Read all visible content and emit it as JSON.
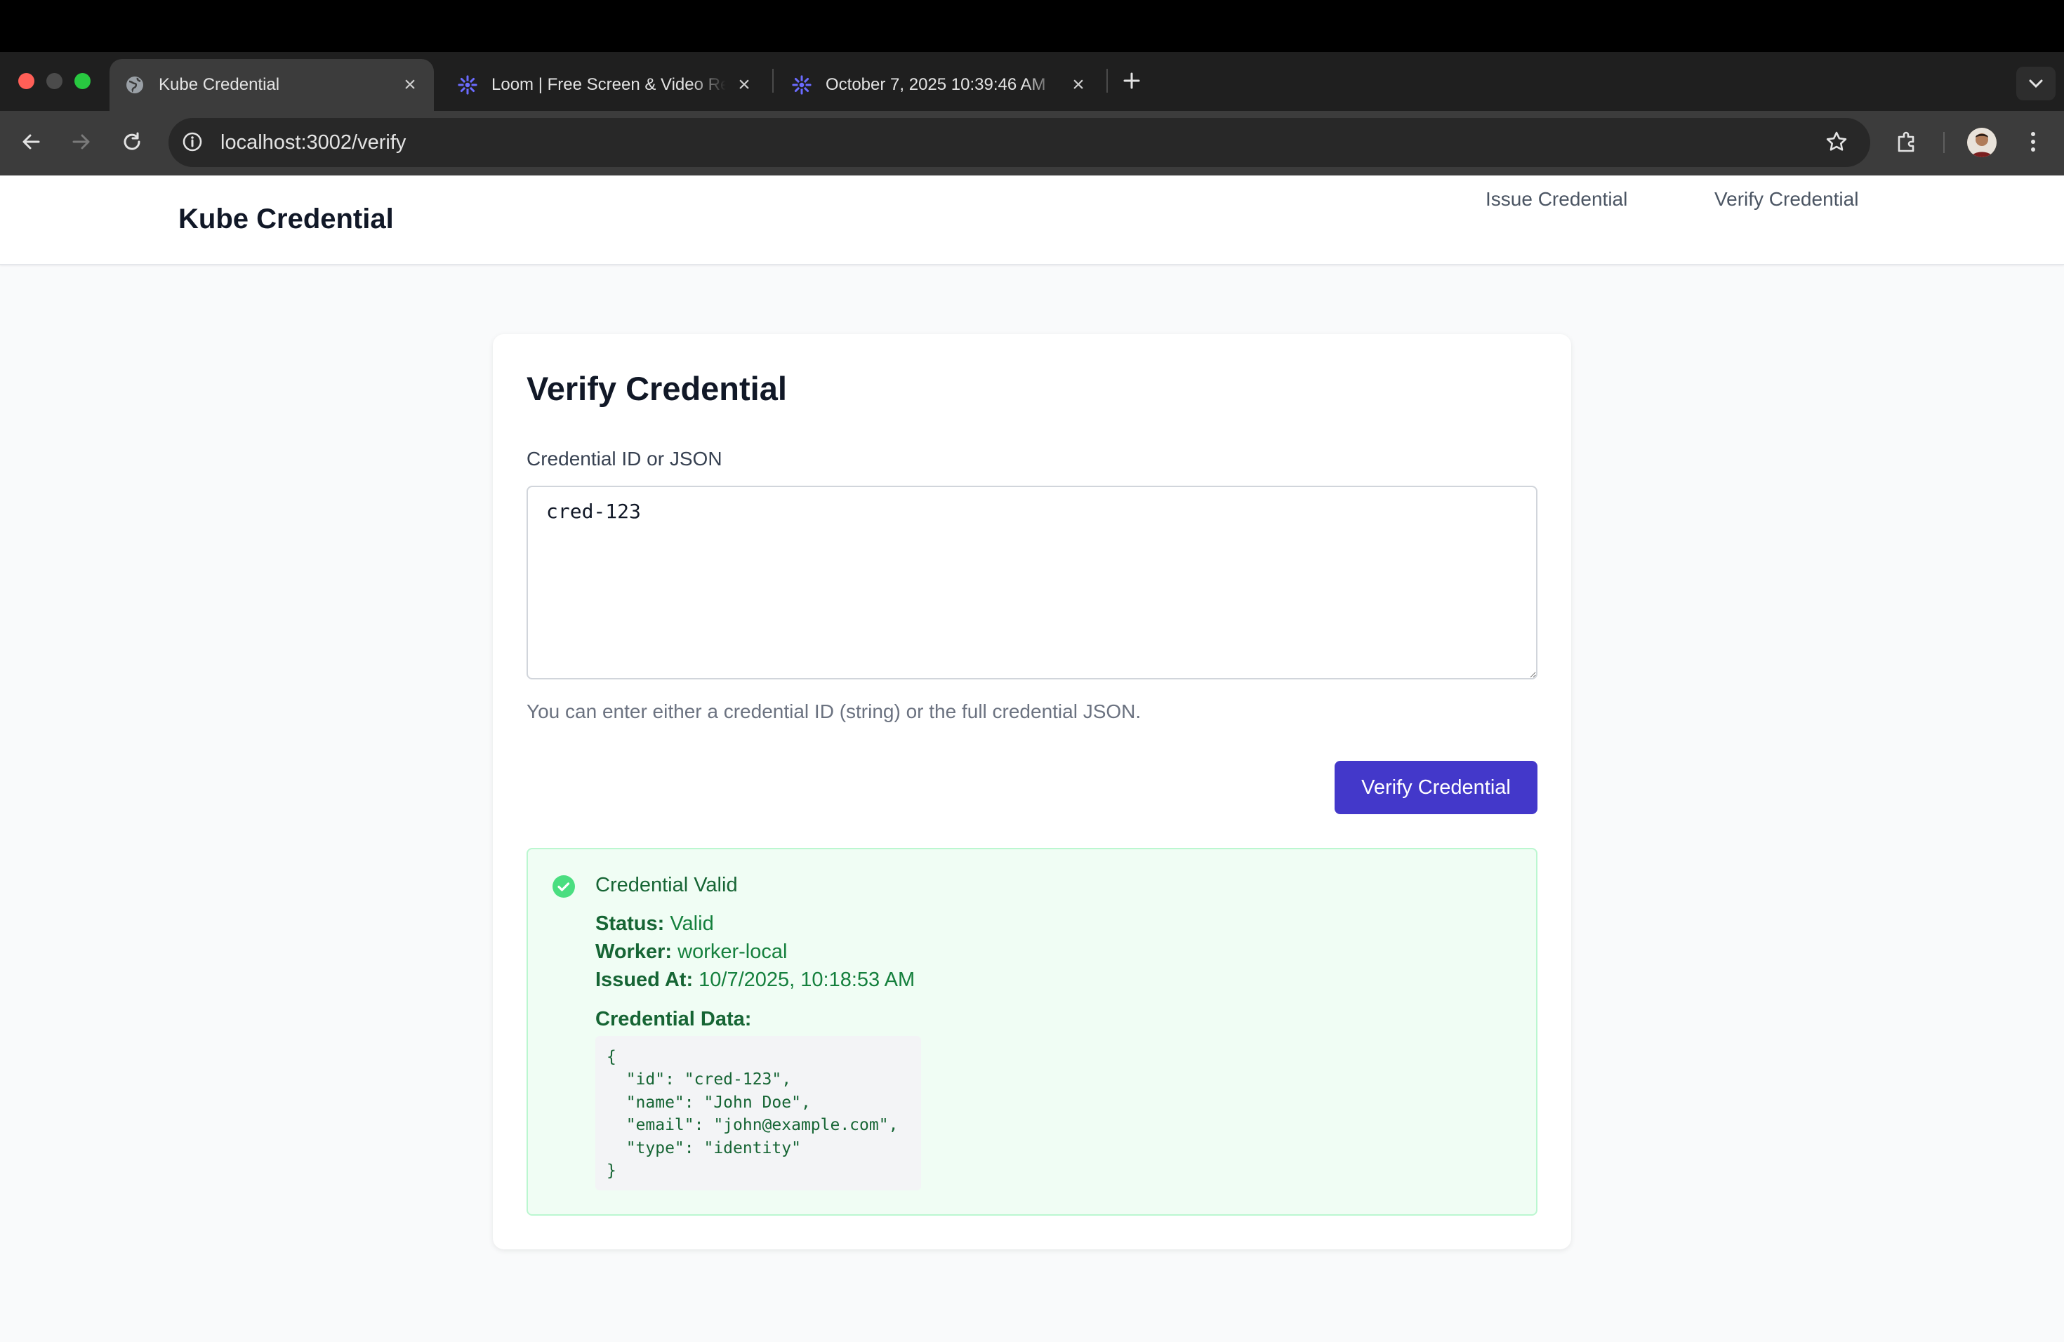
{
  "browser": {
    "tabs": [
      {
        "title": "Kube Credential",
        "active": true,
        "favicon": "globe-icon"
      },
      {
        "title": "Loom | Free Screen & Video Recording",
        "active": false,
        "favicon": "loom-icon"
      },
      {
        "title": "October 7, 2025 10:39:46 AM",
        "active": false,
        "favicon": "loom-icon"
      }
    ],
    "url": "localhost:3002/verify"
  },
  "app": {
    "brand": "Kube Credential",
    "nav": {
      "issue": "Issue Credential",
      "verify": "Verify Credential"
    }
  },
  "form": {
    "title": "Verify Credential",
    "label": "Credential ID or JSON",
    "value": "cred-123",
    "hint": "You can enter either a credential ID (string) or the full credential JSON.",
    "submit": "Verify Credential"
  },
  "result": {
    "title": "Credential Valid",
    "status_label": "Status:",
    "status": "Valid",
    "worker_label": "Worker:",
    "worker": "worker-local",
    "issued_label": "Issued At:",
    "issued": "10/7/2025, 10:18:53 AM",
    "data_label": "Credential Data:",
    "data_json": "{\n  \"id\": \"cred-123\",\n  \"name\": \"John Doe\",\n  \"email\": \"john@example.com\",\n  \"type\": \"identity\"\n}"
  },
  "colors": {
    "primary": "#4338ca",
    "success_bg": "#f0fdf4",
    "success_border": "#bbf7d0",
    "success_text": "#166534"
  }
}
